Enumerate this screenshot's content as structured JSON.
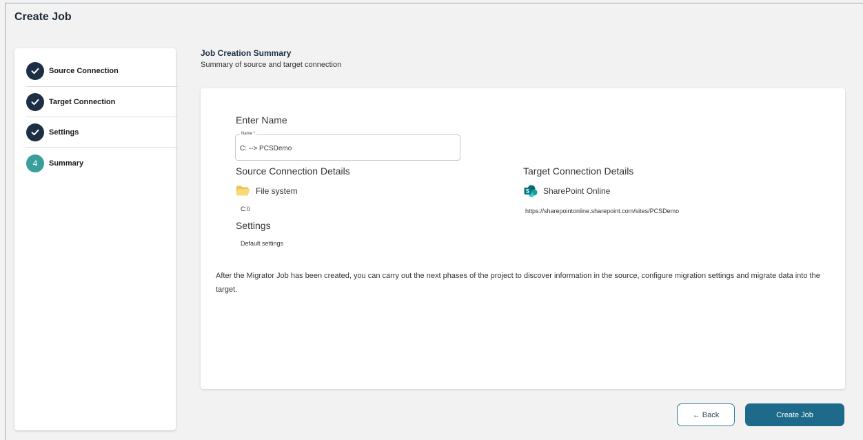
{
  "page": {
    "title": "Create Job"
  },
  "steps": [
    {
      "label": "Source Connection",
      "status": "done"
    },
    {
      "label": "Target Connection",
      "status": "done"
    },
    {
      "label": "Settings",
      "status": "done"
    },
    {
      "label": "Summary",
      "status": "current",
      "number": "4"
    }
  ],
  "summary": {
    "heading": "Job Creation Summary",
    "subheading": "Summary of source and target connection"
  },
  "name_section": {
    "title": "Enter Name",
    "field_label": "Name *",
    "value": "C: --> PCSDemo"
  },
  "source": {
    "title": "Source Connection Details",
    "type_label": "File system",
    "icon": "folder-icon",
    "path": "C:\\\\"
  },
  "target": {
    "title": "Target Connection Details",
    "type_label": "SharePoint Online",
    "icon": "sharepoint-icon",
    "url": "https://sharepointonline.sharepoint.com/sites/PCSDemo"
  },
  "settings": {
    "title": "Settings",
    "value": "Default settings"
  },
  "info_text": "After the Migrator Job has been created, you can carry out the next phases of the project to discover information in the source, configure migration settings and migrate data into the target.",
  "buttons": {
    "back": "← Back",
    "create": "Create Job"
  },
  "colors": {
    "step_done": "#1c2f44",
    "step_current": "#3a9f9c",
    "primary_button": "#1d6a8a"
  }
}
